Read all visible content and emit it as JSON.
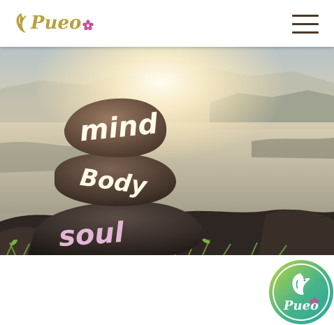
{
  "header": {
    "logo_text": "Pueo",
    "logo_icon": "parrot-leaf-icon",
    "menu_icon": "hamburger-menu-icon"
  },
  "hero": {
    "image": "stacked-stones-sunset-photo",
    "words": [
      "mind",
      "Body",
      "soul"
    ]
  },
  "float_badge": {
    "text": "Pueo",
    "icon": "parrot-icon"
  },
  "colors": {
    "brand_gold": "#b8a13f",
    "flower_pink": "#c34f96",
    "menu_brown": "#4b3824",
    "badge_teal": "#2aa79a",
    "badge_green": "#b9d63f"
  }
}
